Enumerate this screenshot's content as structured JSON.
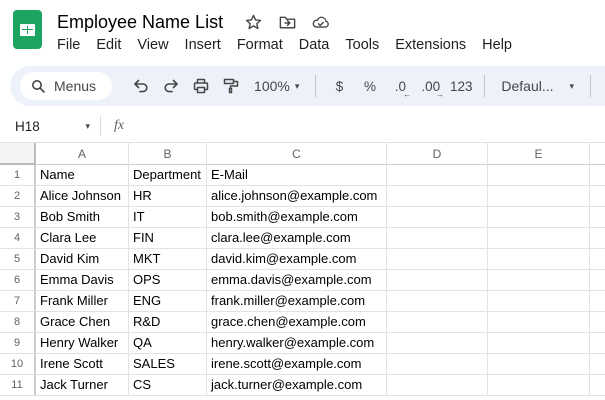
{
  "app": {
    "title": "Employee Name List",
    "logo_color": "#1da362"
  },
  "menu": {
    "items": [
      "File",
      "Edit",
      "View",
      "Insert",
      "Format",
      "Data",
      "Tools",
      "Extensions",
      "Help"
    ]
  },
  "toolbar": {
    "menus_label": "Menus",
    "zoom_value": "100%",
    "format_currency_label": "$",
    "format_percent_label": "%",
    "decrease_decimals_label": ".0",
    "increase_decimals_label": ".00",
    "more_formats_label": "123",
    "number_format_value": "Defaul...",
    "caret_glyph": "▾",
    "decrease_arrow_glyph": "←",
    "increase_arrow_glyph": "→"
  },
  "formula_bar": {
    "cell_reference": "H18",
    "fx_label": "fx"
  },
  "grid": {
    "column_headers": [
      "A",
      "B",
      "C",
      "D",
      "E"
    ],
    "rows": [
      {
        "num": "1",
        "cells": [
          "Name",
          "Department",
          "E-Mail"
        ]
      },
      {
        "num": "2",
        "cells": [
          "Alice Johnson",
          "HR",
          "alice.johnson@example.com"
        ]
      },
      {
        "num": "3",
        "cells": [
          "Bob Smith",
          "IT",
          "bob.smith@example.com"
        ]
      },
      {
        "num": "4",
        "cells": [
          "Clara Lee",
          "FIN",
          "clara.lee@example.com"
        ]
      },
      {
        "num": "5",
        "cells": [
          "David Kim",
          "MKT",
          "david.kim@example.com"
        ]
      },
      {
        "num": "6",
        "cells": [
          "Emma Davis",
          "OPS",
          "emma.davis@example.com"
        ]
      },
      {
        "num": "7",
        "cells": [
          "Frank Miller",
          "ENG",
          "frank.miller@example.com"
        ]
      },
      {
        "num": "8",
        "cells": [
          "Grace Chen",
          "R&D",
          "grace.chen@example.com"
        ]
      },
      {
        "num": "9",
        "cells": [
          "Henry Walker",
          "QA",
          "henry.walker@example.com"
        ]
      },
      {
        "num": "10",
        "cells": [
          "Irene Scott",
          "SALES",
          "irene.scott@example.com"
        ]
      },
      {
        "num": "11",
        "cells": [
          "Jack Turner",
          "CS",
          "jack.turner@example.com"
        ]
      }
    ]
  }
}
